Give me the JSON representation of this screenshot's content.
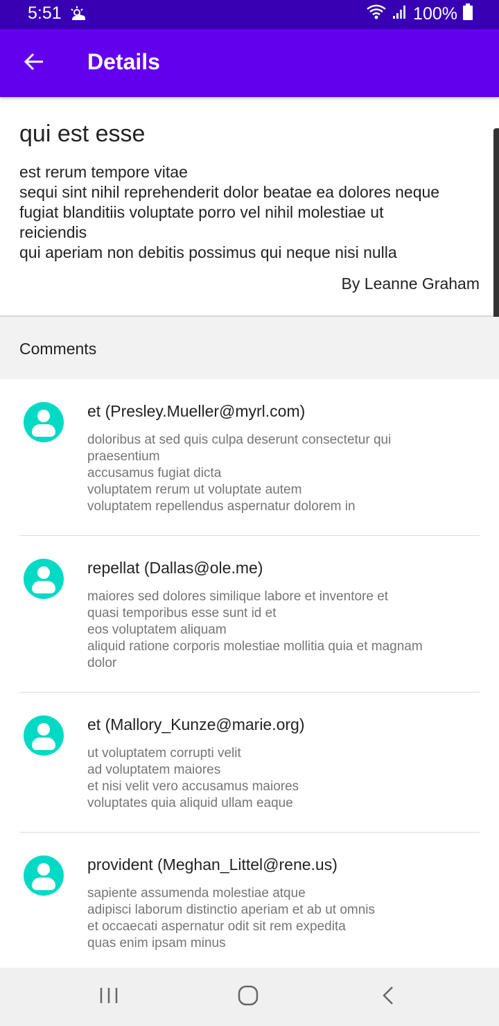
{
  "status_bar": {
    "time": "5:51",
    "battery_text": "100%",
    "weather_icon": "partly-cloudy-icon",
    "wifi_icon": "wifi-icon",
    "signal_icon": "signal-icon",
    "battery_icon": "battery-icon"
  },
  "app_bar": {
    "title": "Details",
    "back_icon": "arrow-back-icon",
    "color": "#6200ee"
  },
  "post": {
    "title": "qui est esse",
    "body": "est rerum tempore vitae\nsequi sint nihil reprehenderit dolor beatae ea dolores neque\nfugiat blanditiis voluptate porro vel nihil molestiae ut\nreiciendis\nqui aperiam non debitis possimus qui neque nisi nulla",
    "author": "By Leanne Graham"
  },
  "comments": {
    "header": "Comments",
    "avatar_color": "#03dac5",
    "items": [
      {
        "name": "et (Presley.Mueller@myrl.com)",
        "body": "doloribus at sed quis culpa deserunt consectetur qui\npraesentium\naccusamus fugiat dicta\nvoluptatem rerum ut voluptate autem\nvoluptatem repellendus aspernatur dolorem in"
      },
      {
        "name": "repellat (Dallas@ole.me)",
        "body": "maiores sed dolores similique labore et inventore et\nquasi temporibus esse sunt id et\neos voluptatem aliquam\naliquid ratione corporis molestiae mollitia quia et magnam\ndolor"
      },
      {
        "name": "et (Mallory_Kunze@marie.org)",
        "body": "ut voluptatem corrupti velit\nad voluptatem maiores\net nisi velit vero accusamus maiores\nvoluptates quia aliquid ullam eaque"
      },
      {
        "name": "provident (Meghan_Littel@rene.us)",
        "body": "sapiente assumenda molestiae atque\nadipisci laborum distinctio aperiam et ab ut omnis\net occaecati aspernatur odit sit rem expedita\nquas enim ipsam minus"
      }
    ]
  },
  "nav_bar": {
    "recents_icon": "recents-icon",
    "home_icon": "home-icon",
    "back_icon": "nav-back-icon"
  }
}
